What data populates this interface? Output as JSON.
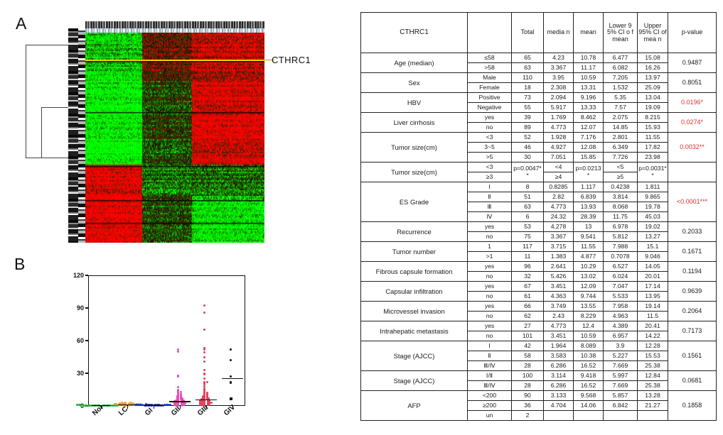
{
  "panels": {
    "a_letter": "A",
    "b_letter": "B",
    "heatmap_gene_label": "CTHRC1"
  },
  "chart_data": [
    {
      "type": "heatmap",
      "title": "CTHRC1",
      "description": "Two-color microarray gene expression heatmap, red-green scale, hierarchical clustering dendrogram at left, CTHRC1 row highlighted in yellow",
      "colorscale": [
        "#00ff00",
        "#000000",
        "#ff0000"
      ],
      "annotations": [
        "CTHRC1"
      ]
    },
    {
      "type": "scatter",
      "title": "",
      "xlabel": "",
      "ylabel": "",
      "ylim": [
        0,
        120
      ],
      "yticks": [
        0,
        30,
        60,
        90,
        120
      ],
      "grid": false,
      "legend": "none",
      "categories": [
        "Nor",
        "LC",
        "GI",
        "GII",
        "GIII",
        "GIV"
      ],
      "series": [
        {
          "name": "Nor",
          "color": "#22aa33",
          "median": 0.4,
          "values": [
            0.2,
            0.3,
            0.5,
            0.4,
            0.6,
            0.3,
            0.7,
            0.4,
            0.2,
            0.5,
            0.8,
            0.3,
            0.6,
            0.4,
            0.5,
            0.3,
            0.7,
            0.4,
            0.9,
            0.2,
            0.5,
            0.6,
            0.3,
            0.4,
            0.7,
            0.5,
            0.3,
            0.8,
            0.4,
            0.6,
            0.2,
            0.5,
            0.4,
            0.7,
            0.3,
            0.6
          ]
        },
        {
          "name": "LC",
          "color": "#eda024",
          "median": 1.0,
          "values": [
            0.5,
            1.2,
            0.8,
            1.5,
            2.0,
            1.1,
            0.9,
            1.8,
            2.4,
            1.3,
            0.7,
            1.6,
            2.8,
            1.0,
            1.4,
            0.6,
            2.2,
            1.9,
            1.1,
            3.2,
            0.8,
            1.5,
            2.6,
            1.2,
            0.9,
            1.7,
            2.1,
            1.3,
            0.7,
            1.4,
            2.9,
            1.0,
            1.8,
            0.6,
            1.2,
            2.3
          ]
        },
        {
          "name": "GI",
          "color": "#1a33cc",
          "median": 0.6,
          "values": [
            0.3,
            0.6,
            0.9,
            0.4,
            1.2,
            0.7,
            0.5,
            1.0,
            0.8,
            0.3,
            1.4,
            0.6,
            0.9,
            0.5,
            1.1,
            0.7,
            0.4,
            0.8,
            1.3,
            0.6,
            0.9,
            0.5,
            1.0,
            0.7,
            0.4,
            1.2,
            0.8,
            0.6
          ]
        },
        {
          "name": "GII",
          "color": "#e84ab8",
          "median": 4.0,
          "values": [
            52,
            50,
            28,
            27,
            17,
            15,
            14,
            13,
            12,
            11,
            10,
            10,
            9,
            9,
            8,
            8,
            7,
            7,
            7,
            6,
            6,
            6,
            5,
            5,
            5,
            4,
            4,
            4,
            4,
            3,
            3,
            3,
            3,
            2,
            2,
            2,
            2,
            2,
            1,
            1,
            1,
            1,
            1,
            0.8,
            0.6,
            0.5,
            0.4,
            0.3,
            9,
            11,
            13,
            6,
            4,
            3,
            2,
            5,
            7,
            8
          ]
        },
        {
          "name": "GIII",
          "color": "#e0405a",
          "median": 5.5,
          "values": [
            92,
            86,
            70,
            53,
            52,
            49,
            45,
            41,
            33,
            30,
            29,
            25,
            22,
            22,
            21,
            20,
            18,
            16,
            15,
            14,
            13,
            12,
            12,
            11,
            10,
            10,
            9,
            9,
            8,
            8,
            8,
            7,
            7,
            7,
            6,
            6,
            6,
            6,
            5,
            5,
            5,
            5,
            4,
            4,
            4,
            4,
            3,
            3,
            3,
            3,
            3,
            2,
            2,
            2,
            2,
            2,
            1,
            1,
            1,
            1,
            1,
            0.8,
            0.5,
            5,
            6,
            7,
            4,
            3,
            9,
            11
          ]
        },
        {
          "name": "GIV",
          "color": "#111111",
          "median": 25,
          "values": [
            52,
            42,
            27,
            22,
            21,
            7
          ]
        }
      ]
    }
  ],
  "table": {
    "headers": [
      "CTHRC1",
      "",
      "Total",
      "media n",
      "mean",
      "Lower 9 5% CI o f mean",
      "Upper 95% CI of mea n",
      "p-value"
    ],
    "rows": [
      {
        "cat": "Age (median)",
        "span": 2,
        "pvalue": "0.9487",
        "pred": false,
        "sub": [
          [
            "≤58",
            "65",
            "4.23",
            "10.78",
            "6.477",
            "15.08"
          ],
          [
            ">58",
            "63",
            "3.367",
            "11.17",
            "6.082",
            "16.26"
          ]
        ]
      },
      {
        "cat": "Sex",
        "span": 2,
        "pvalue": "0.8051",
        "pred": false,
        "sub": [
          [
            "Male",
            "110",
            "3.95",
            "10.59",
            "7.205",
            "13.97"
          ],
          [
            "Female",
            "18",
            "2.308",
            "13.31",
            "1.532",
            "25.09"
          ]
        ]
      },
      {
        "cat": "HBV",
        "span": 2,
        "pvalue": "0.0196*",
        "pred": true,
        "sub": [
          [
            "Positive",
            "73",
            "2.094",
            "9.196",
            "5.35",
            "13.04"
          ],
          [
            "Negative",
            "55",
            "5.917",
            "13.33",
            "7.57",
            "19.09"
          ]
        ]
      },
      {
        "cat": "Liver cirrhosis",
        "span": 2,
        "pvalue": "0.0274*",
        "pred": true,
        "sub": [
          [
            "yes",
            "39",
            "1.769",
            "8.462",
            "2.075",
            "8.215"
          ],
          [
            "no",
            "89",
            "4.773",
            "12.07",
            "14.85",
            "15.93"
          ]
        ]
      },
      {
        "cat": "Tumor size(cm)",
        "span": 3,
        "pvalue": "0.0032**",
        "pred": true,
        "sub": [
          [
            "<3",
            "52",
            "1.928",
            "7.176",
            "2.801",
            "11.55"
          ],
          [
            "3~5",
            "46",
            "4.927",
            "12.08",
            "6.349",
            "17.82"
          ],
          [
            ">5",
            "30",
            "7.051",
            "15.85",
            "7.726",
            "23.98"
          ]
        ]
      },
      {
        "cat": "Tumor size(cm)",
        "span": 2,
        "pvalue": "",
        "pred": false,
        "special": true,
        "sub": [
          [
            "<3",
            "p=0.0047**",
            "<4",
            "p=0.0213*",
            "<5",
            "p=0.0031**"
          ],
          [
            "≥3",
            "",
            "≥4",
            "",
            "≥5",
            ""
          ]
        ]
      },
      {
        "cat": "ES Grade",
        "span": 4,
        "pvalue": "<0.0001***",
        "pred": true,
        "sub": [
          [
            "Ⅰ",
            "8",
            "0.8285",
            "1.117",
            "0.4238",
            "1.811"
          ],
          [
            "Ⅱ",
            "51",
            "2.82",
            "6.839",
            "3.814",
            "9.865"
          ],
          [
            "Ⅲ",
            "63",
            "4.773",
            "13.93",
            "8.068",
            "19.78"
          ],
          [
            "Ⅳ",
            "6",
            "24.32",
            "28.39",
            "11.75",
            "45.03"
          ]
        ]
      },
      {
        "cat": "Recurrence",
        "span": 2,
        "pvalue": "0.2033",
        "pred": false,
        "sub": [
          [
            "yes",
            "53",
            "4.278",
            "13",
            "6.978",
            "19.02"
          ],
          [
            "no",
            "75",
            "3.367",
            "9.541",
            "5.812",
            "13.27"
          ]
        ]
      },
      {
        "cat": "Tumor number",
        "span": 2,
        "pvalue": "0.1671",
        "pred": false,
        "sub": [
          [
            "1",
            "117",
            "3.715",
            "11.55",
            "7.988",
            "15.1"
          ],
          [
            ">1",
            "11",
            "1.383",
            "4.877",
            "0.7078",
            "9.046"
          ]
        ]
      },
      {
        "cat": "Fibrous capsule formation",
        "span": 2,
        "pvalue": "0.1194",
        "pred": false,
        "sub": [
          [
            "yes",
            "96",
            "2.641",
            "10.29",
            "6.527",
            "14.05"
          ],
          [
            "no",
            "32",
            "5.426",
            "13.02",
            "6.024",
            "20.01"
          ]
        ]
      },
      {
        "cat": "Capsular infiltration",
        "span": 2,
        "pvalue": "0.9639",
        "pred": false,
        "sub": [
          [
            "yes",
            "67",
            "3.451",
            "12.09",
            "7.047",
            "17.14"
          ],
          [
            "no",
            "61",
            "4.363",
            "9.744",
            "5.533",
            "13.95"
          ]
        ]
      },
      {
        "cat": "Microvessel invasion",
        "span": 2,
        "pvalue": "0.2064",
        "pred": false,
        "sub": [
          [
            "yes",
            "66",
            "3.749",
            "13.55",
            "7.958",
            "19.14"
          ],
          [
            "no",
            "62",
            "2.43",
            "8.229",
            "4.963",
            "11.5"
          ]
        ]
      },
      {
        "cat": "Intrahepatic metastasis",
        "span": 2,
        "pvalue": "0.7173",
        "pred": false,
        "sub": [
          [
            "yes",
            "27",
            "4.773",
            "12.4",
            "4.389",
            "20.41"
          ],
          [
            "no",
            "101",
            "3.451",
            "10.59",
            "6.957",
            "14.22"
          ]
        ]
      },
      {
        "cat": "Stage (AJCC)",
        "span": 3,
        "pvalue": "0.1561",
        "pred": false,
        "sub": [
          [
            "Ⅰ",
            "42",
            "1.964",
            "8.089",
            "3.9",
            "12.28"
          ],
          [
            "Ⅱ",
            "58",
            "3.583",
            "10.38",
            "5.227",
            "15.53"
          ],
          [
            "Ⅲ/Ⅳ",
            "28",
            "6.286",
            "16.52",
            "7.669",
            "25.38"
          ]
        ]
      },
      {
        "cat": "Stage (AJCC)",
        "span": 2,
        "pvalue": "0.0681",
        "pred": false,
        "sub": [
          [
            "Ⅰ/Ⅱ",
            "100",
            "3.114",
            "9.418",
            "5.997",
            "12.84"
          ],
          [
            "Ⅲ/Ⅳ",
            "28",
            "6.286",
            "16.52",
            "7.669",
            "25.38"
          ]
        ]
      },
      {
        "cat": "AFP",
        "span": 3,
        "pvalue": "0.1858",
        "pred": false,
        "sub": [
          [
            "<200",
            "90",
            "3.133",
            "9.568",
            "5.857",
            "13.28"
          ],
          [
            "≥200",
            "36",
            "4.704",
            "14.06",
            "6.842",
            "21.27"
          ],
          [
            "un",
            "2",
            "",
            "",
            "",
            ""
          ]
        ]
      }
    ]
  }
}
